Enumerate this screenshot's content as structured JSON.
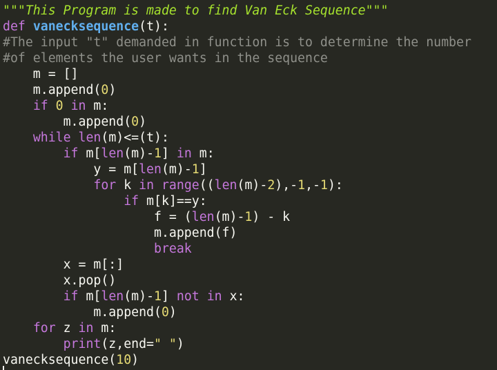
{
  "colors": {
    "background": "#272822",
    "default_text": "#f8f8f2",
    "docstring": "#a6e22e",
    "keyword": "#c678dd",
    "function_name": "#61afef",
    "builtin": "#c678dd",
    "number": "#e6db74",
    "comment": "#8f908a",
    "string": "#e6db74",
    "operator": "#f8f8f2"
  },
  "editor": {
    "lines": [
      {
        "tokens": [
          {
            "t": "\"\"\"This Program is made to find Van Eck Sequence\"\"\"",
            "k": "docstring"
          }
        ]
      },
      {
        "tokens": [
          {
            "t": "def ",
            "k": "keyword"
          },
          {
            "t": "vanecksequence",
            "k": "function_name"
          },
          {
            "t": "(t):",
            "k": "plain"
          }
        ]
      },
      {
        "tokens": [
          {
            "t": "#The input \"t\" demanded in function is to determine the number",
            "k": "comment"
          }
        ]
      },
      {
        "tokens": [
          {
            "t": "#of elements the user wants in the sequence",
            "k": "comment"
          }
        ]
      },
      {
        "tokens": [
          {
            "t": "    m = []",
            "k": "plain"
          }
        ]
      },
      {
        "tokens": [
          {
            "t": "    m.append(",
            "k": "plain"
          },
          {
            "t": "0",
            "k": "number"
          },
          {
            "t": ")",
            "k": "plain"
          }
        ]
      },
      {
        "tokens": [
          {
            "t": "    ",
            "k": "plain"
          },
          {
            "t": "if",
            "k": "keyword"
          },
          {
            "t": " ",
            "k": "plain"
          },
          {
            "t": "0",
            "k": "number"
          },
          {
            "t": " ",
            "k": "plain"
          },
          {
            "t": "in",
            "k": "keyword"
          },
          {
            "t": " m:",
            "k": "plain"
          }
        ]
      },
      {
        "tokens": [
          {
            "t": "        m.append(",
            "k": "plain"
          },
          {
            "t": "0",
            "k": "number"
          },
          {
            "t": ")",
            "k": "plain"
          }
        ]
      },
      {
        "tokens": [
          {
            "t": "    ",
            "k": "plain"
          },
          {
            "t": "while",
            "k": "keyword"
          },
          {
            "t": " ",
            "k": "plain"
          },
          {
            "t": "len",
            "k": "builtin"
          },
          {
            "t": "(m)<=(t):",
            "k": "plain"
          }
        ]
      },
      {
        "tokens": [
          {
            "t": "        ",
            "k": "plain"
          },
          {
            "t": "if",
            "k": "keyword"
          },
          {
            "t": " m[",
            "k": "plain"
          },
          {
            "t": "len",
            "k": "builtin"
          },
          {
            "t": "(m)-",
            "k": "plain"
          },
          {
            "t": "1",
            "k": "number"
          },
          {
            "t": "] ",
            "k": "plain"
          },
          {
            "t": "in",
            "k": "keyword"
          },
          {
            "t": " m:",
            "k": "plain"
          }
        ]
      },
      {
        "tokens": [
          {
            "t": "            y = m[",
            "k": "plain"
          },
          {
            "t": "len",
            "k": "builtin"
          },
          {
            "t": "(m)-",
            "k": "plain"
          },
          {
            "t": "1",
            "k": "number"
          },
          {
            "t": "]",
            "k": "plain"
          }
        ]
      },
      {
        "tokens": [
          {
            "t": "            ",
            "k": "plain"
          },
          {
            "t": "for",
            "k": "keyword"
          },
          {
            "t": " k ",
            "k": "plain"
          },
          {
            "t": "in",
            "k": "keyword"
          },
          {
            "t": " ",
            "k": "plain"
          },
          {
            "t": "range",
            "k": "builtin"
          },
          {
            "t": "((",
            "k": "plain"
          },
          {
            "t": "len",
            "k": "builtin"
          },
          {
            "t": "(m)-",
            "k": "plain"
          },
          {
            "t": "2",
            "k": "number"
          },
          {
            "t": "),-",
            "k": "plain"
          },
          {
            "t": "1",
            "k": "number"
          },
          {
            "t": ",-",
            "k": "plain"
          },
          {
            "t": "1",
            "k": "number"
          },
          {
            "t": "):",
            "k": "plain"
          }
        ]
      },
      {
        "tokens": [
          {
            "t": "                ",
            "k": "plain"
          },
          {
            "t": "if",
            "k": "keyword"
          },
          {
            "t": " m[k]==y:",
            "k": "plain"
          }
        ]
      },
      {
        "tokens": [
          {
            "t": "                    f = (",
            "k": "plain"
          },
          {
            "t": "len",
            "k": "builtin"
          },
          {
            "t": "(m)-",
            "k": "plain"
          },
          {
            "t": "1",
            "k": "number"
          },
          {
            "t": ") - k",
            "k": "plain"
          }
        ]
      },
      {
        "tokens": [
          {
            "t": "                    m.append(f)",
            "k": "plain"
          }
        ]
      },
      {
        "tokens": [
          {
            "t": "                    ",
            "k": "plain"
          },
          {
            "t": "break",
            "k": "keyword"
          }
        ]
      },
      {
        "tokens": [
          {
            "t": "        x = m[:]",
            "k": "plain"
          }
        ]
      },
      {
        "tokens": [
          {
            "t": "        x.pop()",
            "k": "plain"
          }
        ]
      },
      {
        "tokens": [
          {
            "t": "        ",
            "k": "plain"
          },
          {
            "t": "if",
            "k": "keyword"
          },
          {
            "t": " m[",
            "k": "plain"
          },
          {
            "t": "len",
            "k": "builtin"
          },
          {
            "t": "(m)-",
            "k": "plain"
          },
          {
            "t": "1",
            "k": "number"
          },
          {
            "t": "] ",
            "k": "plain"
          },
          {
            "t": "not",
            "k": "keyword"
          },
          {
            "t": " ",
            "k": "plain"
          },
          {
            "t": "in",
            "k": "keyword"
          },
          {
            "t": " x:",
            "k": "plain"
          }
        ]
      },
      {
        "tokens": [
          {
            "t": "            m.append(",
            "k": "plain"
          },
          {
            "t": "0",
            "k": "number"
          },
          {
            "t": ")",
            "k": "plain"
          }
        ]
      },
      {
        "tokens": [
          {
            "t": "    ",
            "k": "plain"
          },
          {
            "t": "for",
            "k": "keyword"
          },
          {
            "t": " z ",
            "k": "plain"
          },
          {
            "t": "in",
            "k": "keyword"
          },
          {
            "t": " m:",
            "k": "plain"
          }
        ]
      },
      {
        "tokens": [
          {
            "t": "        ",
            "k": "plain"
          },
          {
            "t": "print",
            "k": "builtin"
          },
          {
            "t": "(z,end=",
            "k": "plain"
          },
          {
            "t": "\" \"",
            "k": "string"
          },
          {
            "t": ")",
            "k": "plain"
          }
        ]
      },
      {
        "tokens": [
          {
            "t": "vanecksequence(",
            "k": "plain"
          },
          {
            "t": "10",
            "k": "number"
          },
          {
            "t": ")",
            "k": "plain"
          }
        ]
      }
    ]
  }
}
